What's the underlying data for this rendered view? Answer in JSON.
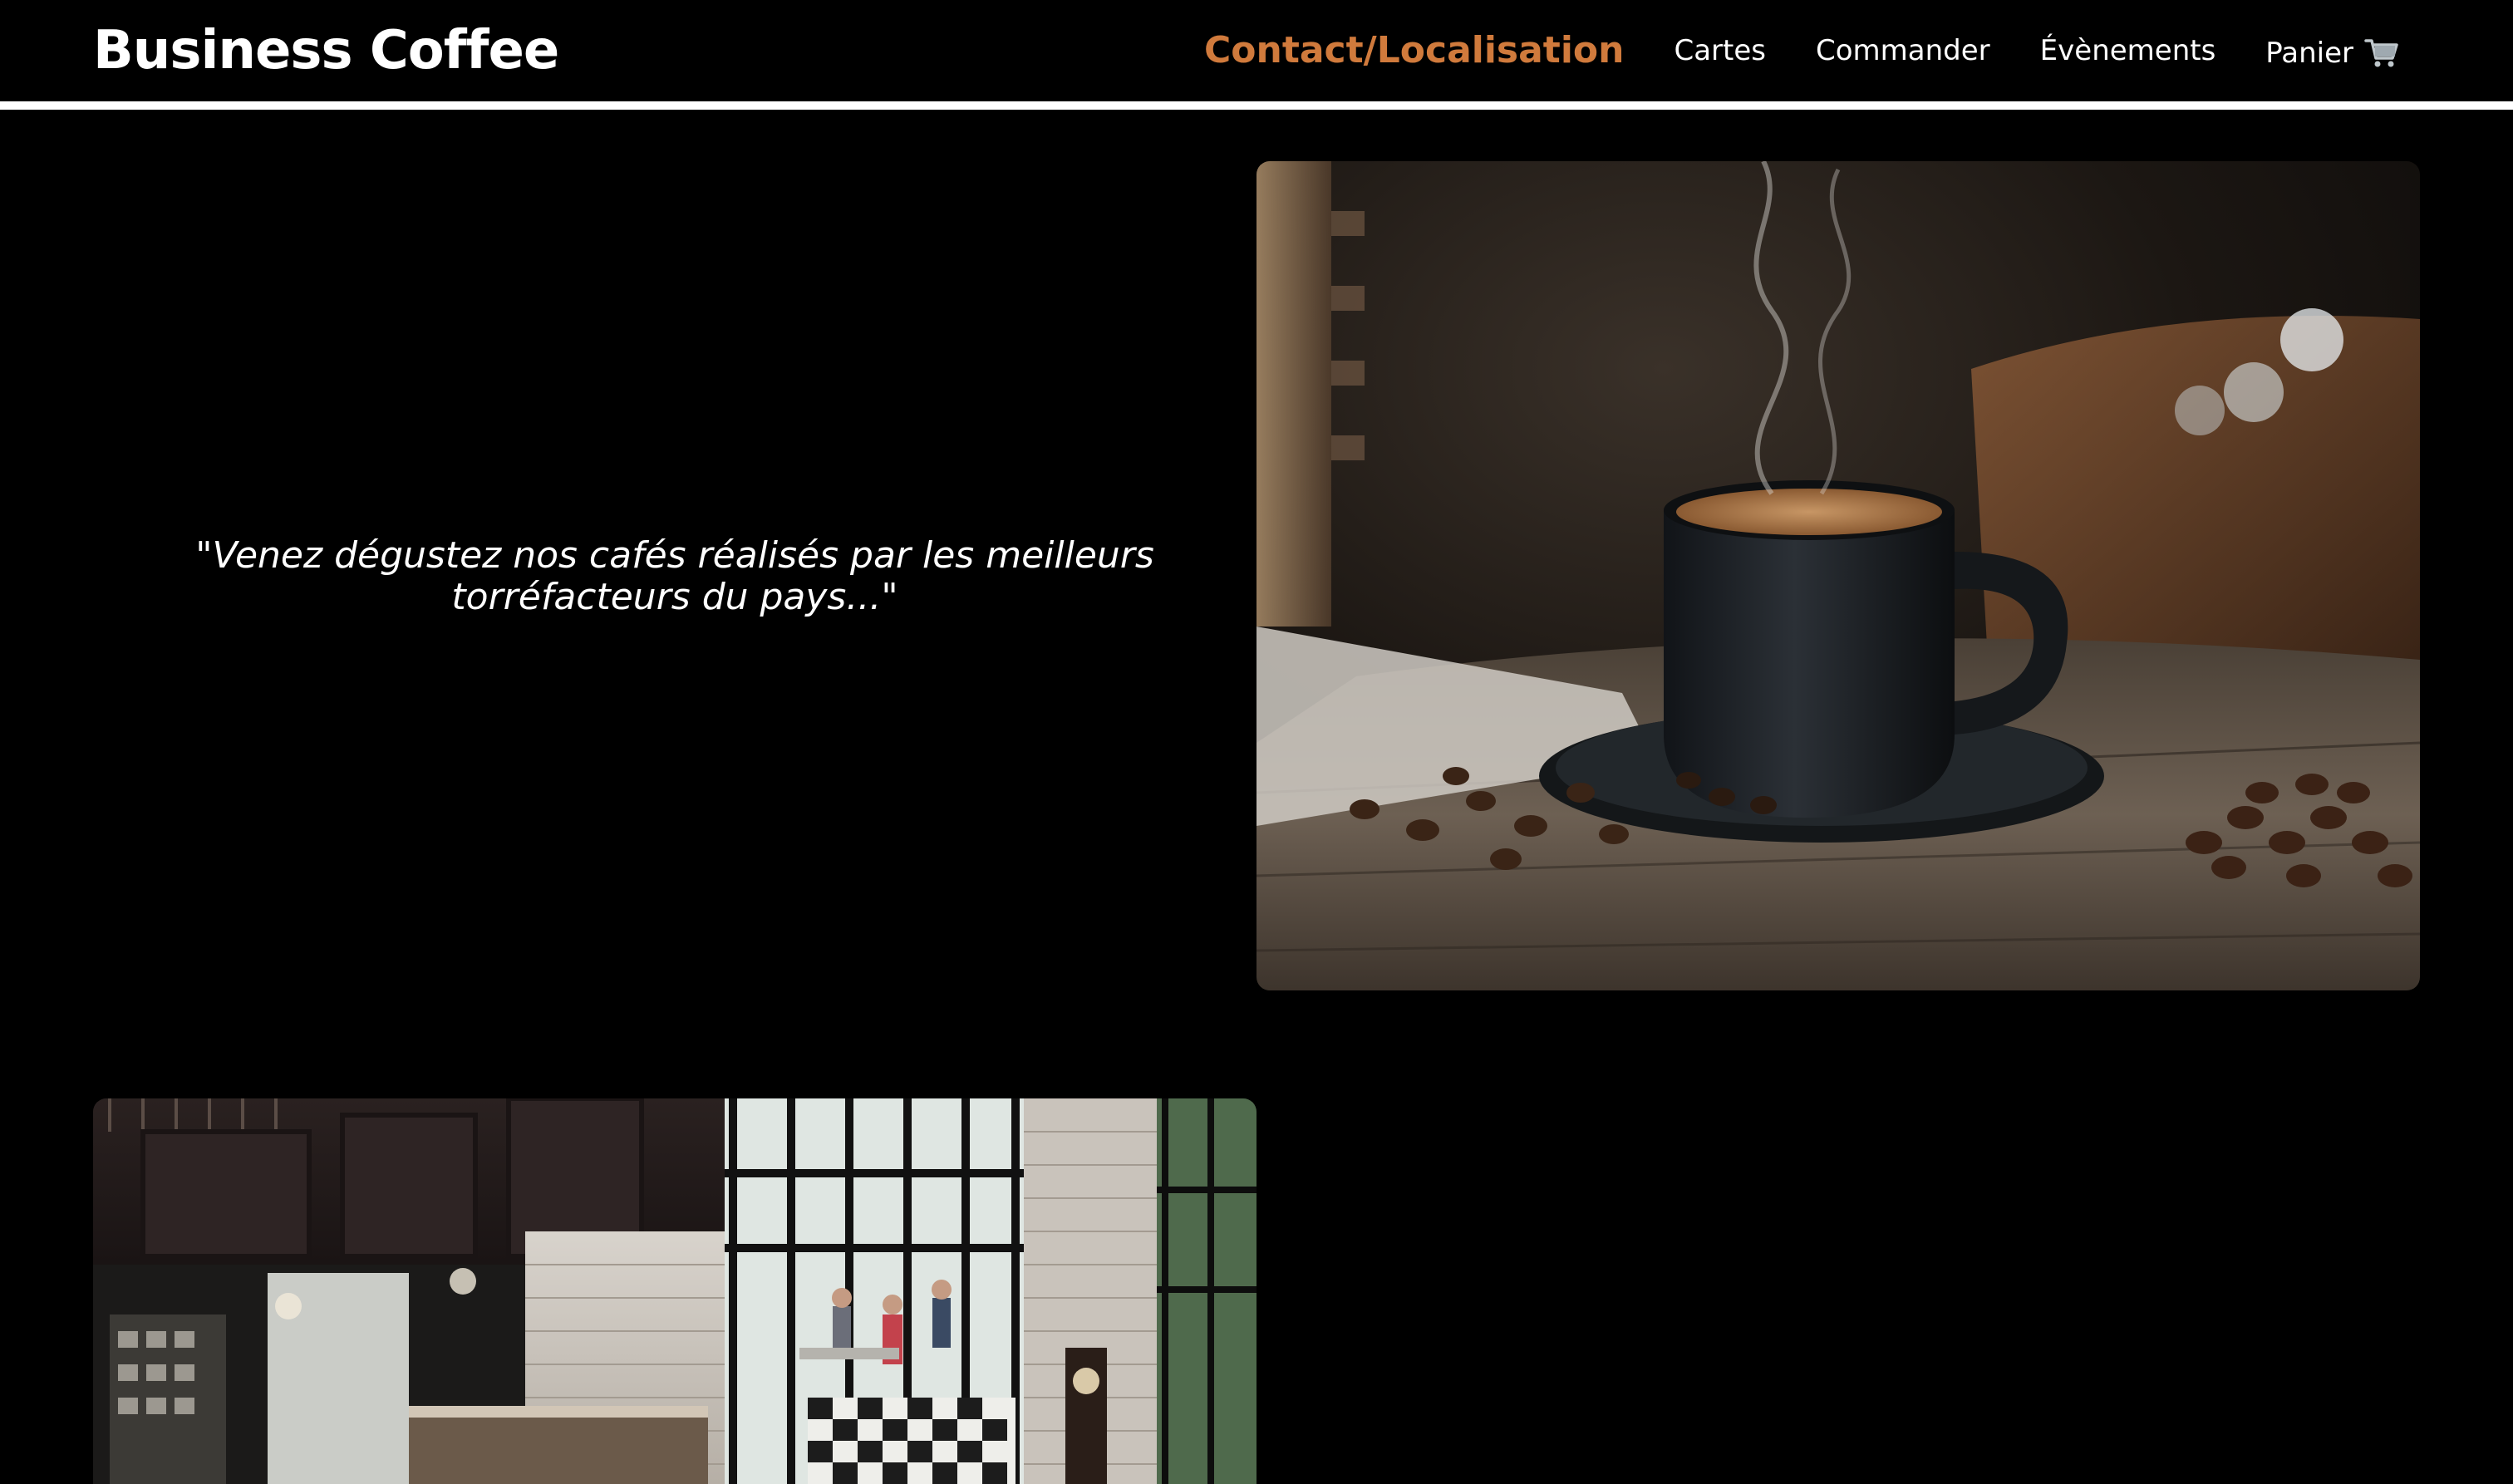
{
  "header": {
    "brand": "Business Coffee",
    "nav": [
      {
        "label": "Contact/Localisation",
        "active": true
      },
      {
        "label": "Cartes",
        "active": false
      },
      {
        "label": "Commander",
        "active": false
      },
      {
        "label": "Évènements",
        "active": false
      }
    ],
    "cart_label": "Panier",
    "cart_icon": "shopping-cart-icon"
  },
  "hero": {
    "quote": "\"Venez dégustez nos cafés réalisés par les meilleurs torréfacteurs du pays...\""
  },
  "colors": {
    "background": "#000000",
    "accent": "#d07a3c",
    "text": "#ffffff"
  }
}
